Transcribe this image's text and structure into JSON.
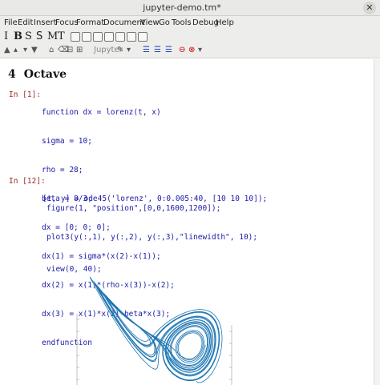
{
  "window": {
    "title": "jupyter-demo.tm*",
    "close_glyph": "✕"
  },
  "menu": [
    "File",
    "Edit",
    "Insert",
    "Focus",
    "Format",
    "Document",
    "View",
    "Go",
    "Tools",
    "Debug",
    "Help"
  ],
  "toolbar": {
    "letters": [
      "I",
      "B",
      "S",
      "S",
      "M",
      "T"
    ],
    "session_label": "Jupyter",
    "icons": [
      "bold-icon",
      "italic-icon",
      "table-icon",
      "image-icon",
      "copy-icon",
      "paste-icon",
      "page-icon"
    ]
  },
  "section": {
    "number": "4",
    "title": "Octave"
  },
  "cells": [
    {
      "prompt": "In [1]:",
      "lines": [
        "function dx = lorenz(t, x)",
        "sigma = 10;",
        "rho = 28;",
        "beta = 8/3;",
        "dx = [0; 0; 0];",
        "dx(1) = sigma*(x(2)-x(1));",
        "dx(2) = x(1)*(rho-x(3))-x(2);",
        "dx(3) = x(1)*x(2)-beta*x(3);",
        "endfunction"
      ]
    },
    {
      "prompt": "In [12]:",
      "lines": [
        "[t, y] = ode45('lorenz', 0:0.005:40, [10 10 10]);",
        "figure(1, \"position\",[0,0,1600,1200]);",
        "plot3(y(:,1), y(:,2), y(:,3),\"linewidth\", 10);",
        "view(0, 40);"
      ]
    }
  ],
  "colors": {
    "line": "#1f77b4",
    "prompt": "#9a2a2a",
    "code": "#1a1aa8"
  }
}
